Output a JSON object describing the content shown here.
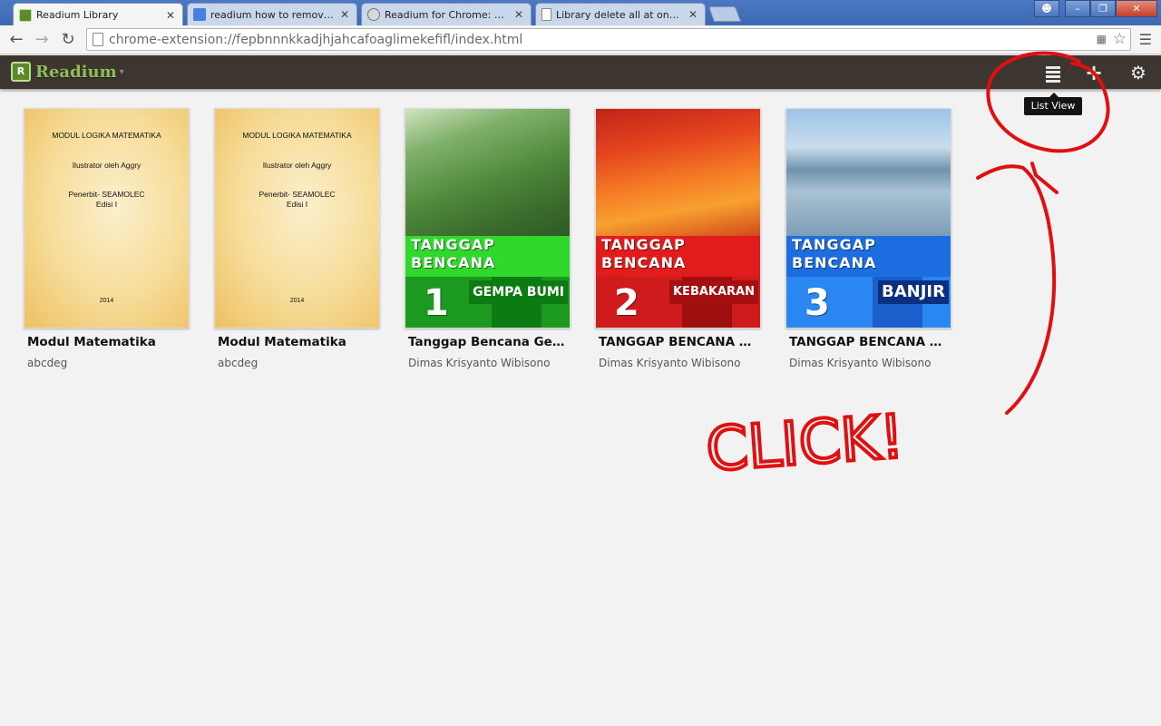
{
  "browser": {
    "tabs": [
      {
        "title": "Readium Library",
        "active": true
      },
      {
        "title": "readium how to remove -",
        "active": false
      },
      {
        "title": "Readium for Chrome: Getti",
        "active": false
      },
      {
        "title": "Library delete all at ones/k",
        "active": false
      }
    ],
    "tab_close": "✕",
    "url": "chrome-extension://fepbnnnkkadjhjahcafoaglimekefifl/index.html"
  },
  "app": {
    "logo_text": "Readium",
    "tooltip": "List View"
  },
  "books": [
    {
      "title": "Modul Matematika",
      "author": "abcdeg",
      "cover": {
        "line1": "MODUL LOGIKA MATEMATIKA",
        "line2": "Ilustrator oleh Aggry",
        "line3": "Penerbit- SEAMOLEC",
        "line4": "Edisi I",
        "year": "2014"
      }
    },
    {
      "title": "Modul Matematika",
      "author": "abcdeg",
      "cover": {
        "line1": "MODUL LOGIKA MATEMATIKA",
        "line2": "Ilustrator oleh Aggry",
        "line3": "Penerbit- SEAMOLEC",
        "line4": "Edisi I",
        "year": "2014"
      }
    },
    {
      "title": "Tanggap Bencana Ge…",
      "author": "Dimas Krisyanto Wibisono",
      "cover": {
        "line1": "TANGGAP",
        "line2": "BENCANA",
        "number": "1",
        "kind": "GEMPA BUMI"
      }
    },
    {
      "title": "TANGGAP BENCANA K…",
      "author": "Dimas Krisyanto Wibisono",
      "cover": {
        "line1": "TANGGAP",
        "line2": "BENCANA",
        "number": "2",
        "kind": "KEBAKARAN"
      }
    },
    {
      "title": "TANGGAP BENCANA B…",
      "author": "Dimas Krisyanto Wibisono",
      "cover": {
        "line1": "TANGGAP",
        "line2": "BENCANA",
        "number": "3",
        "kind": "BANJIR"
      }
    }
  ],
  "annotation": {
    "text": "CLICK!"
  },
  "colors": {
    "appbar": "#3c3530",
    "logo_green": "#8fbf5a",
    "annotation_red": "#e01010",
    "cover_green": "#22c02a",
    "cover_red": "#e02020",
    "cover_blue": "#1f74e8"
  }
}
